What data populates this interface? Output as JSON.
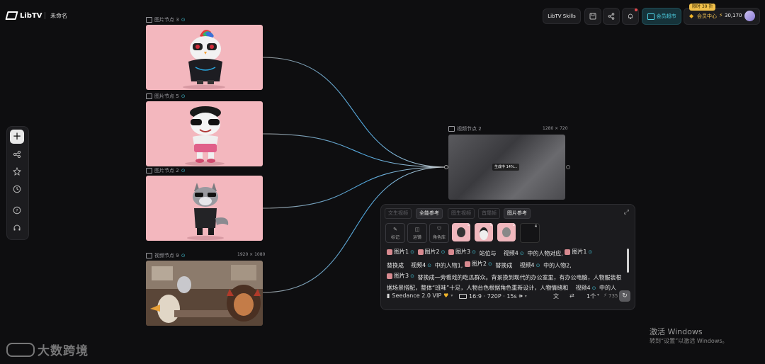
{
  "app": {
    "logo": "LibTV",
    "doc_title": "未命名"
  },
  "header": {
    "skills_label": "LibTV Skills",
    "member_promo_label": "会员超市",
    "promo_badge": "限时 39 折",
    "member_center_label": "会员中心",
    "credits": "30,170"
  },
  "nodes": [
    {
      "label": "图片节点 3",
      "dims": ""
    },
    {
      "label": "图片节点 5",
      "dims": ""
    },
    {
      "label": "图片节点 2",
      "dims": ""
    },
    {
      "label": "视频节点 9",
      "dims": "1920 × 1080"
    }
  ],
  "video_node": {
    "label": "视频节点 2",
    "dims": "1280 × 720",
    "status": "生成中 14%..."
  },
  "panel": {
    "tabs": [
      "文生视频",
      "全能参考",
      "图生视频",
      "首尾帧",
      "图片参考"
    ],
    "tools": [
      "标记",
      "运镜",
      "角色库"
    ],
    "thumb_nums": [
      "3",
      "5",
      "2",
      "4"
    ],
    "prompt": {
      "t_pic1": "图片1",
      "t_pic2": "图片2",
      "t_pic3": "图片3",
      "t_vid4": "视频4",
      "w_zhanwei": "站位与",
      "w_duiying": "中的人物对应,",
      "w_tihuancheng": "替换成",
      "w_renwu1": "中的人物1,",
      "w_renwu2": "中的人物2,",
      "w_line3": "替换成一旁看戏的吃瓜群众。背景换到现代的办公室里，有办公电脑，人物服装根",
      "w_line4": "据场景搭配，整体“班味”十足，人物台色根据角色重新设计，人物情绪和",
      "w_zhongde": "中的人"
    },
    "model": "Seedance 2.0 VIP",
    "settings": "16:9 · 720P · 15s",
    "count": "1个",
    "cost": "735"
  },
  "watermark": {
    "brand": "大数跨境",
    "win_title": "激活 Windows",
    "win_sub": "转到“设置”以激活 Windows。"
  }
}
